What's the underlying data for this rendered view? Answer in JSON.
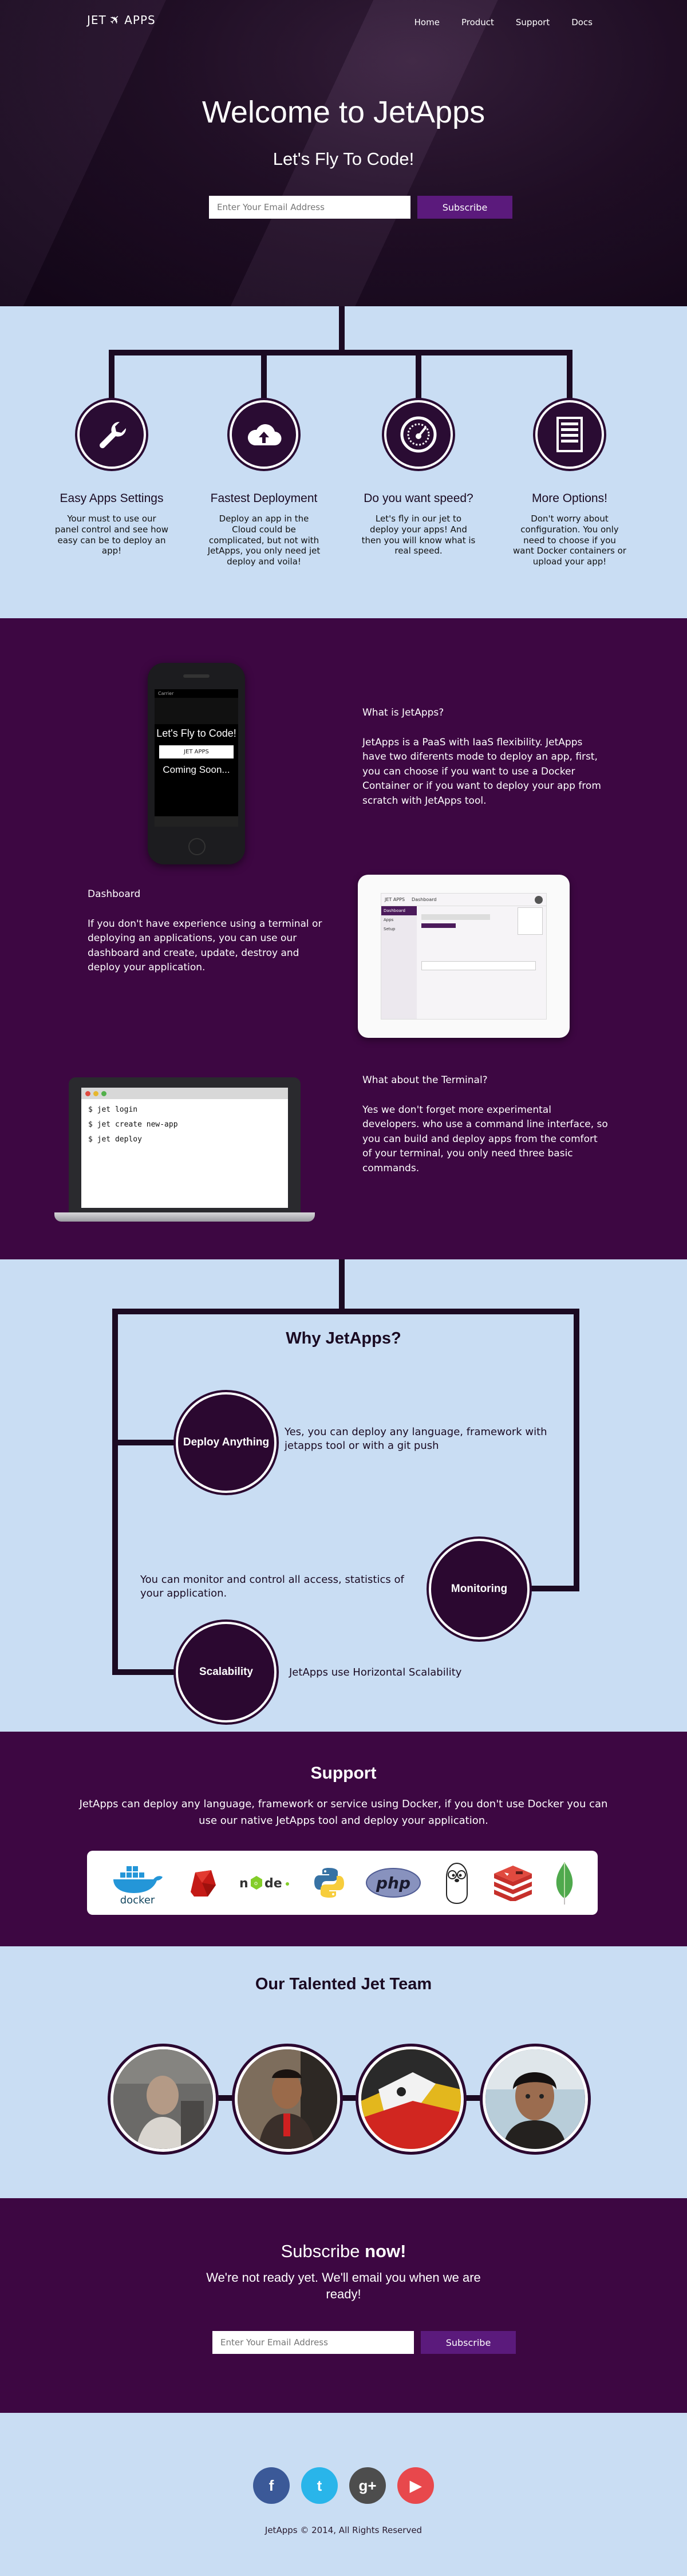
{
  "nav": {
    "logo": "JET",
    "logo_suffix": "APPS",
    "items": [
      "Home",
      "Product",
      "Support",
      "Docs"
    ]
  },
  "hero": {
    "title": "Welcome to JetApps",
    "subtitle": "Let's Fly To Code!",
    "email_placeholder": "Enter Your Email Address",
    "subscribe_label": "Subscribe"
  },
  "features": [
    {
      "icon": "wrench-icon",
      "title": "Easy Apps Settings",
      "text": "Your must to use our panel control and see how easy can be to deploy an app!"
    },
    {
      "icon": "cloud-upload-icon",
      "title": "Fastest Deployment",
      "text": "Deploy an app in the Cloud could be complicated, but not with JetApps, you only need jet deploy and voila!"
    },
    {
      "icon": "speedometer-icon",
      "title": "Do you want speed?",
      "text": "Let's fly in our jet to deploy your apps! And then you will know what is real speed."
    },
    {
      "icon": "server-icon",
      "title": "More Options!",
      "text": "Don't worry about configuration. You only need to choose if you want Docker containers or upload your app!"
    }
  ],
  "what": {
    "phone_title": "Let's Fly to Code!",
    "phone_logo": "JET APPS",
    "phone_coming": "Coming Soon...",
    "phone_carrier": "Carrier",
    "what_title": "What is JetApps?",
    "what_text": "JetApps is a PaaS with IaaS flexibility. JetApps have two diferents mode to deploy an app, first, you can choose if you want to use a Docker Container or if you want to deploy your app from scratch with JetApps tool.",
    "dash_title": "Dashboard",
    "dash_text": "If you don't have experience using a terminal or deploying an applications, you can use our dashboard and create, update, destroy and deploy your application.",
    "tablet_logo": "JET APPS",
    "tablet_heading": "Dashboard",
    "tablet_menu": [
      "Dashboard",
      "Apps",
      "Setup"
    ],
    "term_title": "What about the Terminal?",
    "term_text": "Yes we don't forget more experimental developers. who use a command line interface, so you can build and deploy apps from the comfort of your terminal, you only need three basic commands.",
    "commands": [
      "$ jet login",
      "$ jet create new-app",
      "$ jet deploy"
    ]
  },
  "why": {
    "title": "Why JetApps?",
    "items": [
      {
        "label": "Deploy Anything",
        "text": "Yes, you can deploy any language, framework with jetapps tool or with a git push"
      },
      {
        "label": "Monitoring",
        "text": "You can monitor and control all access, statistics of your application."
      },
      {
        "label": "Scalability",
        "text": "JetApps use Horizontal Scalability"
      }
    ]
  },
  "support": {
    "title": "Support",
    "text": "JetApps can deploy any language, framework or service using Docker, if you don't use Docker you can use our native JetApps tool and deploy your application.",
    "logos": [
      "docker",
      "ruby",
      "node",
      "python",
      "php",
      "go",
      "redis",
      "mongodb"
    ]
  },
  "team": {
    "title": "Our Talented Jet Team"
  },
  "subscribe": {
    "title_plain": "Subscribe ",
    "title_bold": "now!",
    "message": "We're not ready yet. We'll email you when we are ready!",
    "email_placeholder": "Enter Your Email Address",
    "button": "Subscribe"
  },
  "footer": {
    "social": [
      {
        "icon": "facebook-icon",
        "glyph": "f",
        "color": "#3b5998"
      },
      {
        "icon": "twitter-icon",
        "glyph": "t",
        "color": "#29b5ea"
      },
      {
        "icon": "google-plus-icon",
        "glyph": "g+",
        "color": "#4d4d4d"
      },
      {
        "icon": "youtube-icon",
        "glyph": "▶",
        "color": "#e8484c"
      }
    ],
    "copyright": "JetApps © 2014, All Rights Reserved"
  }
}
